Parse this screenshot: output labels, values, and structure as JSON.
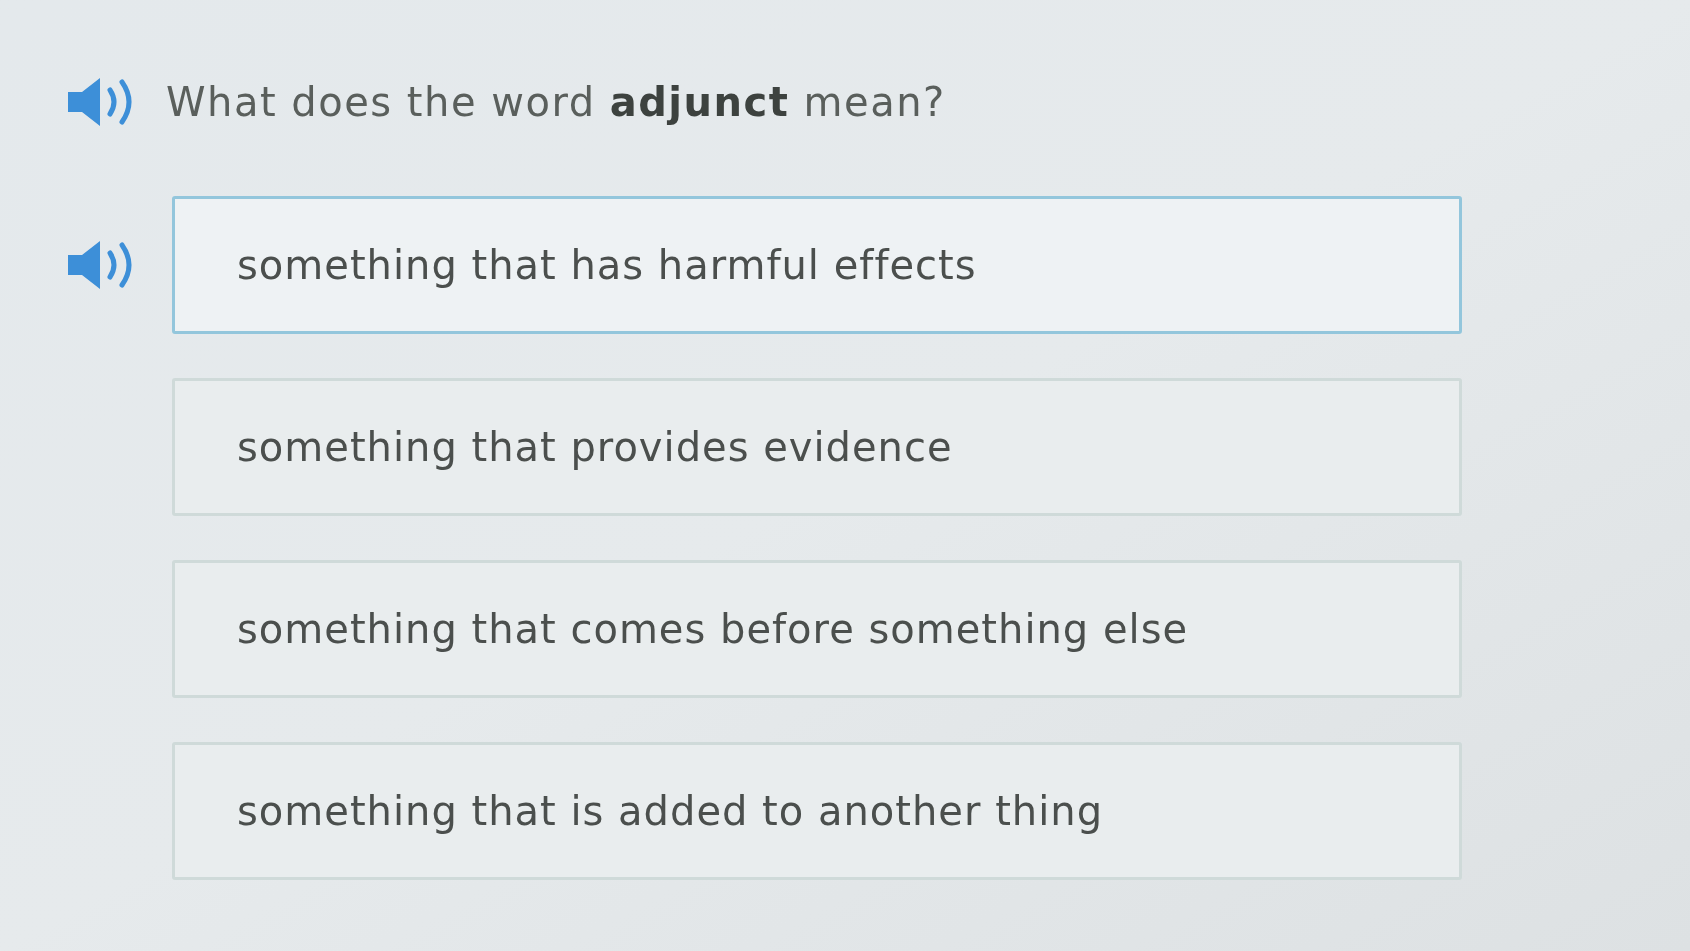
{
  "question": {
    "text": "What does the word **adjunct** mean?"
  },
  "options": [
    {
      "text": "something that has harmful effects",
      "selected": true
    },
    {
      "text": "something that provides evidence",
      "selected": false
    },
    {
      "text": "something that comes before something else",
      "selected": false
    },
    {
      "text": "something that is added to another thing",
      "selected": false
    }
  ]
}
